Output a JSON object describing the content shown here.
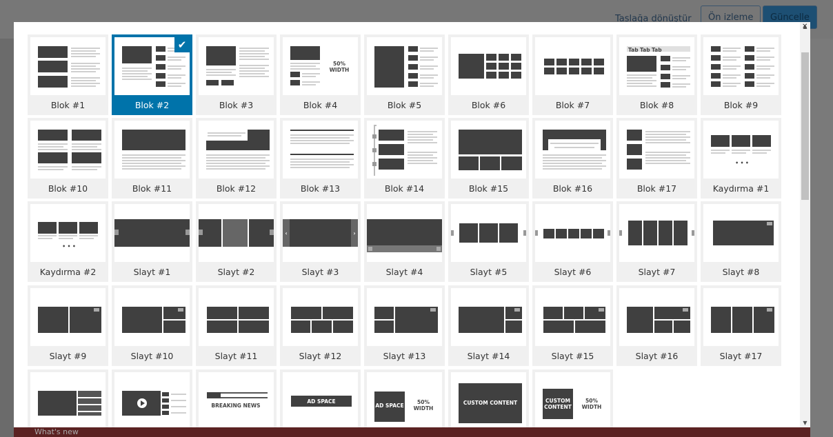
{
  "background": {
    "toolbar_link": "Taslağa dönüştür",
    "preview_button": "Ön izleme",
    "update_button": "Güncelle",
    "bottom_text": "What's new"
  },
  "modal": {
    "tiles": [
      {
        "label": "Blok #1"
      },
      {
        "label": "Blok #2",
        "selected": true
      },
      {
        "label": "Blok #3"
      },
      {
        "label": "Blok #4"
      },
      {
        "label": "Blok #5"
      },
      {
        "label": "Blok #6"
      },
      {
        "label": "Blok #7"
      },
      {
        "label": "Blok #8"
      },
      {
        "label": "Blok #9"
      },
      {
        "label": "Blok #10"
      },
      {
        "label": "Blok #11"
      },
      {
        "label": "Blok #12"
      },
      {
        "label": "Blok #13"
      },
      {
        "label": "Blok #14"
      },
      {
        "label": "Blok #15"
      },
      {
        "label": "Blok #16"
      },
      {
        "label": "Blok #17"
      },
      {
        "label": "Kaydırma #1"
      },
      {
        "label": "Kaydırma #2"
      },
      {
        "label": "Slayt #1"
      },
      {
        "label": "Slayt #2"
      },
      {
        "label": "Slayt #3"
      },
      {
        "label": "Slayt #4"
      },
      {
        "label": "Slayt #5"
      },
      {
        "label": "Slayt #6"
      },
      {
        "label": "Slayt #7"
      },
      {
        "label": "Slayt #8"
      },
      {
        "label": "Slayt #9"
      },
      {
        "label": "Slayt #10"
      },
      {
        "label": "Slayt #11"
      },
      {
        "label": "Slayt #12"
      },
      {
        "label": "Slayt #13"
      },
      {
        "label": "Slayt #14"
      },
      {
        "label": "Slayt #15"
      },
      {
        "label": "Slayt #16"
      },
      {
        "label": "Slayt #17"
      },
      {
        "label": ""
      },
      {
        "label": ""
      },
      {
        "label": ""
      },
      {
        "label": ""
      },
      {
        "label": ""
      },
      {
        "label": ""
      },
      {
        "label": ""
      }
    ],
    "thumb_text": {
      "width_50": "50% WIDTH",
      "breaking_news": "BREAKING NEWS",
      "ad_space": "AD SPACE",
      "custom_content": "CUSTOM CONTENT",
      "mini_tabs": [
        "Tab",
        "Tab",
        "Tab"
      ]
    },
    "close_icon": "close-icon",
    "check_icon": "check-icon"
  }
}
